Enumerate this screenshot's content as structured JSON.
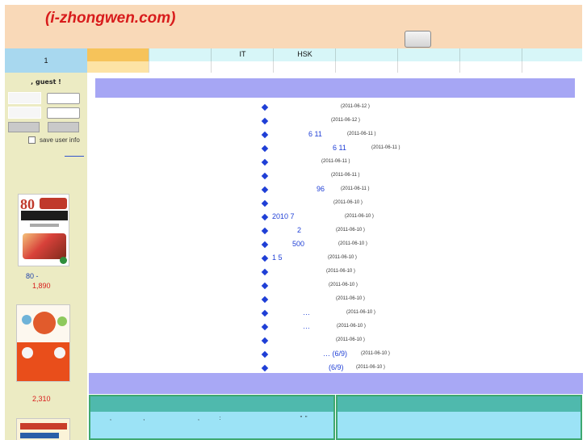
{
  "header": {
    "logo_text": "(i-zhongwen.com)",
    "button_label": ""
  },
  "nav": {
    "items": [
      {
        "label": "1"
      },
      {
        "label": ""
      },
      {
        "label": ""
      },
      {
        "label": "IT"
      },
      {
        "label": "HSK"
      },
      {
        "label": ""
      },
      {
        "label": ""
      },
      {
        "label": ""
      },
      {
        "label": ""
      }
    ]
  },
  "sidebar": {
    "greeting": ", guest   !",
    "save_user_info": "save user info",
    "books": [
      {
        "title": "80  -",
        "price": "1,890"
      },
      {
        "title": "",
        "price": "2,310"
      }
    ]
  },
  "main": {
    "news": [
      {
        "title": "",
        "date": "(2011-06-12    )"
      },
      {
        "title": "",
        "date": "(2011-06-12    )"
      },
      {
        "title": "6 11",
        "date": "(2011-06-11    )"
      },
      {
        "title": "6 11",
        "date": "(2011-06-11    )"
      },
      {
        "title": "",
        "date": "(2011-06-11    )"
      },
      {
        "title": "",
        "date": "(2011-06-11    )"
      },
      {
        "title": "96",
        "date": "(2011-06-11    )"
      },
      {
        "title": "",
        "date": "(2011-06-10    )"
      },
      {
        "title": "2010  7",
        "date": "(2011-06-10    )"
      },
      {
        "title": "2",
        "date": "(2011-06-10    )"
      },
      {
        "title": "500",
        "date": "(2011-06-10    )"
      },
      {
        "title": "1 5",
        "date": "(2011-06-10    )"
      },
      {
        "title": "",
        "date": "(2011-06-10    )"
      },
      {
        "title": "",
        "date": "(2011-06-10    )"
      },
      {
        "title": "",
        "date": "(2011-06-10    )"
      },
      {
        "title": "…",
        "date": "(2011-06-10    )"
      },
      {
        "title": "…",
        "date": "(2011-06-10    )"
      },
      {
        "title": "",
        "date": "(2011-06-10    )"
      },
      {
        "title": "… (6/9)",
        "date": "(2011-06-10    )"
      },
      {
        "title": "(6/9)",
        "date": "(2011-06-10    )"
      }
    ]
  },
  "panel_left": {
    "text": ",             ,                      ,        :                                 \" \""
  }
}
